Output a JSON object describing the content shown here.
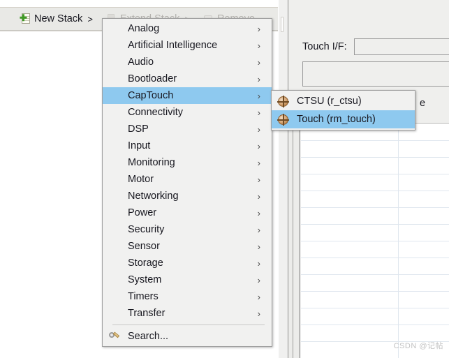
{
  "toolbar": {
    "items": [
      {
        "label": "New Stack",
        "arrow": ">",
        "icon": "new-stack-icon",
        "disabled": false
      },
      {
        "label": "Extend Stack",
        "arrow": ">",
        "icon": "extend-stack-icon",
        "disabled": true
      },
      {
        "label": "Remove",
        "arrow": "",
        "icon": "remove-icon",
        "disabled": true
      }
    ]
  },
  "menu": {
    "items": [
      {
        "label": "Analog",
        "caret": "›"
      },
      {
        "label": "Artificial Intelligence",
        "caret": "›"
      },
      {
        "label": "Audio",
        "caret": "›"
      },
      {
        "label": "Bootloader",
        "caret": "›"
      },
      {
        "label": "CapTouch",
        "caret": "›"
      },
      {
        "label": "Connectivity",
        "caret": "›"
      },
      {
        "label": "DSP",
        "caret": "›"
      },
      {
        "label": "Input",
        "caret": "›"
      },
      {
        "label": "Monitoring",
        "caret": "›"
      },
      {
        "label": "Motor",
        "caret": "›"
      },
      {
        "label": "Networking",
        "caret": "›"
      },
      {
        "label": "Power",
        "caret": "›"
      },
      {
        "label": "Security",
        "caret": "›"
      },
      {
        "label": "Sensor",
        "caret": "›"
      },
      {
        "label": "Storage",
        "caret": "›"
      },
      {
        "label": "System",
        "caret": "›"
      },
      {
        "label": "Timers",
        "caret": "›"
      },
      {
        "label": "Transfer",
        "caret": "›"
      }
    ],
    "selected_index": 4,
    "search": {
      "label": "Search...",
      "icon": "search-icon"
    }
  },
  "submenu": {
    "parent": "CapTouch",
    "items": [
      {
        "label": "CTSU (r_ctsu)",
        "icon": "ctsu-module-icon",
        "selected": false
      },
      {
        "label": "Touch (rm_touch)",
        "icon": "touch-module-icon",
        "selected": true
      }
    ]
  },
  "properties_panel": {
    "touch_if_label": "Touch I/F:",
    "touch_if_value": "",
    "touch_if_placeholder": "",
    "secondary_value": "",
    "occluded_text": "e"
  },
  "colors": {
    "menu_background": "#f1f1f0",
    "menu_border": "#a0a0a0",
    "selection_blue": "#8ec9ef",
    "toolbar_background": "#e9e9e6",
    "panel_background": "#efefed",
    "disabled_text": "#b4b2ae",
    "grid_line": "#dfe6ee",
    "icon_copper": "#b98146",
    "accent_green": "#3f9a24"
  },
  "watermark": {
    "text": "CSDN @记帖"
  }
}
